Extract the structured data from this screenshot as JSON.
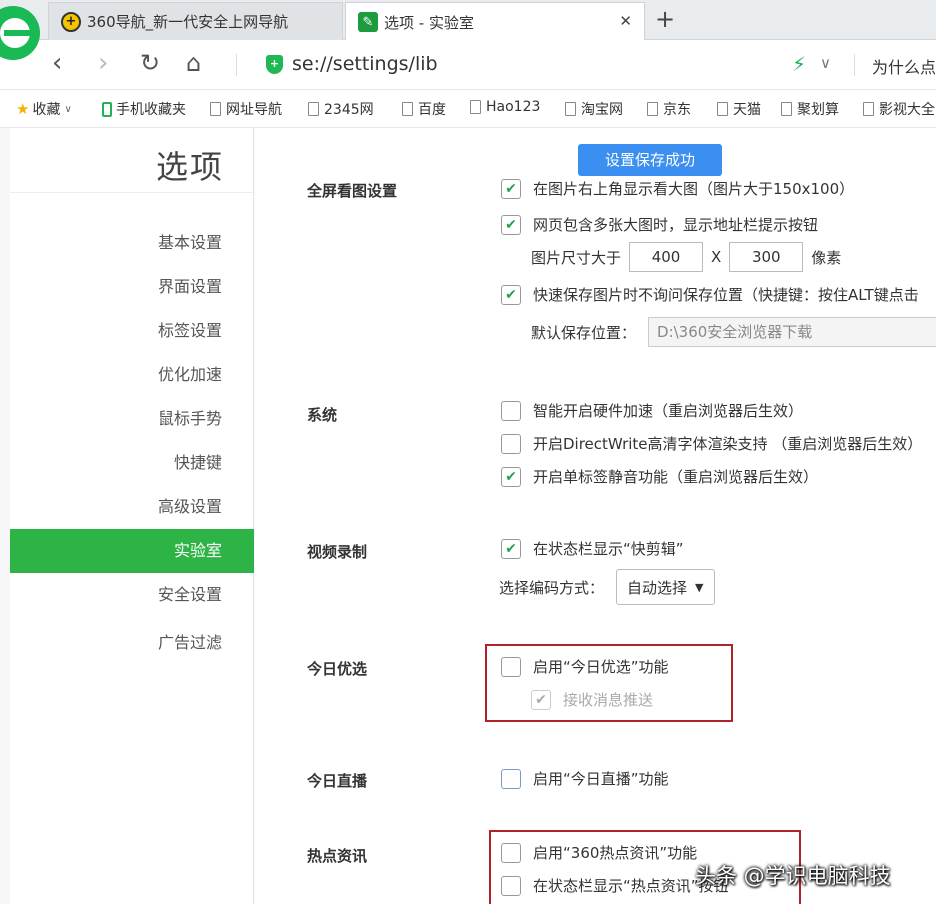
{
  "tabs": [
    {
      "label": "360导航_新一代安全上网导航",
      "active": false
    },
    {
      "label": "选项 - 实验室",
      "active": true
    }
  ],
  "addressbar": {
    "url": "se://settings/lib",
    "right_text": "为什么点"
  },
  "bookmarks": [
    {
      "label": "收藏",
      "icon": "star-icon"
    },
    {
      "label": "手机收藏夹",
      "icon": "phone-icon"
    },
    {
      "label": "网址导航",
      "icon": "page-icon"
    },
    {
      "label": "2345网",
      "icon": "page-icon"
    },
    {
      "label": "百度",
      "icon": "page-icon"
    },
    {
      "label": "Hao123",
      "icon": "page-icon"
    },
    {
      "label": "淘宝网",
      "icon": "page-icon"
    },
    {
      "label": "京东",
      "icon": "page-icon"
    },
    {
      "label": "天猫",
      "icon": "page-icon"
    },
    {
      "label": "聚划算",
      "icon": "page-icon"
    },
    {
      "label": "影视大全",
      "icon": "page-icon"
    }
  ],
  "sidebar": {
    "title": "选项",
    "items": [
      {
        "label": "基本设置",
        "active": false
      },
      {
        "label": "界面设置",
        "active": false
      },
      {
        "label": "标签设置",
        "active": false
      },
      {
        "label": "优化加速",
        "active": false
      },
      {
        "label": "鼠标手势",
        "active": false
      },
      {
        "label": "快捷键",
        "active": false
      },
      {
        "label": "高级设置",
        "active": false
      },
      {
        "label": "实验室",
        "active": true
      },
      {
        "label": "安全设置",
        "active": false
      },
      {
        "label": "广告过滤",
        "active": false
      }
    ]
  },
  "toast": "设置保存成功",
  "fullscreen": {
    "label": "全屏看图设置",
    "top_option": "在图片右上角显示看大图（图片大于150x100）",
    "multi_image": "网页包含多张大图时，显示地址栏提示按钮",
    "size_prefix": "图片尺寸大于",
    "width": "400",
    "times": "X",
    "height": "300",
    "unit": "像素",
    "quick_save": "快速保存图片时不询问保存位置（快捷键：按住ALT键点击",
    "save_path_label": "默认保存位置：",
    "save_path": "D:\\360安全浏览器下载"
  },
  "system": {
    "label": "系统",
    "options": [
      {
        "label": "智能开启硬件加速（重启浏览器后生效）",
        "checked": false
      },
      {
        "label": "开启DirectWrite高清字体渲染支持 （重启浏览器后生效）",
        "checked": false
      },
      {
        "label": "开启单标签静音功能（重启浏览器后生效）",
        "checked": true
      }
    ]
  },
  "video": {
    "label": "视频录制",
    "option": "在状态栏显示“快剪辑”",
    "codec_label": "选择编码方式：",
    "codec_value": "自动选择"
  },
  "today_pick": {
    "label": "今日优选",
    "option": "启用“今日优选”功能",
    "sub_option": "接收消息推送"
  },
  "today_live": {
    "label": "今日直播",
    "option": "启用“今日直播”功能"
  },
  "hot_news": {
    "label": "热点资讯",
    "option": "启用“360热点资讯”功能",
    "sub_option": "在状态栏显示“热点资讯”按钮"
  },
  "watermark": "头条 @学识电脑科技",
  "colors": {
    "accent": "#2eb346",
    "highlight": "#b0232a",
    "toast": "#3b8ff0"
  }
}
